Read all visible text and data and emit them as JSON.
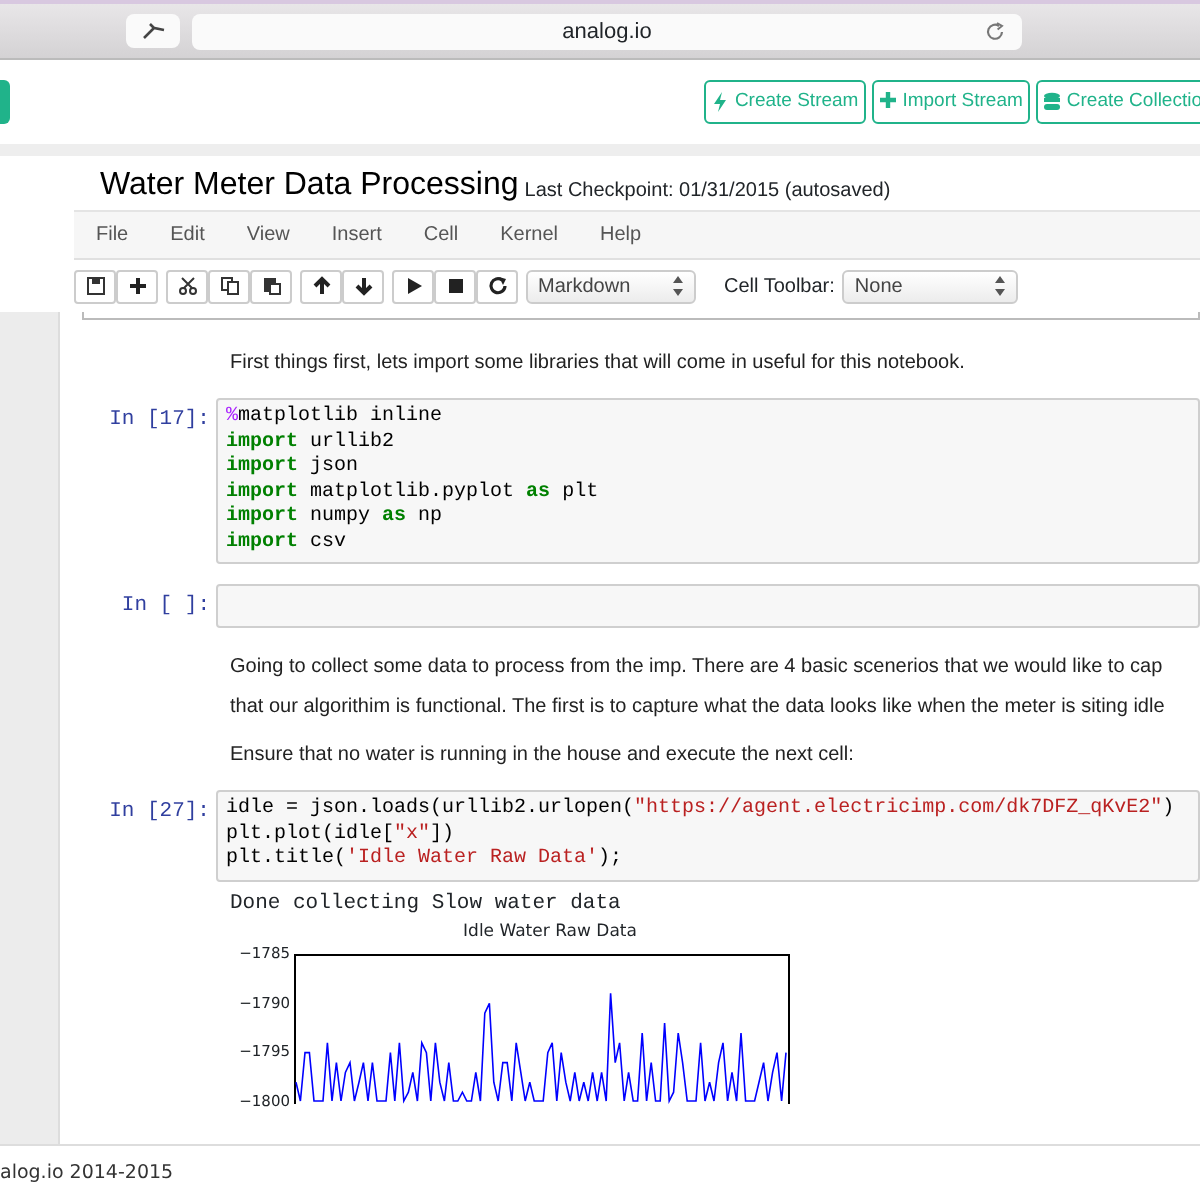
{
  "browser": {
    "address": "analog.io"
  },
  "header": {
    "buttons": [
      {
        "label": "Create Stream",
        "kind": "bolt"
      },
      {
        "label": "Import Stream",
        "kind": "plus"
      },
      {
        "label": "Create Collectio",
        "kind": "db"
      }
    ]
  },
  "notebook": {
    "title": "Water Meter Data Processing",
    "checkpoint": "Last Checkpoint: 01/31/2015 (autosaved)"
  },
  "menu": [
    "File",
    "Edit",
    "View",
    "Insert",
    "Cell",
    "Kernel",
    "Help"
  ],
  "toolbar": {
    "groups": [
      [
        {
          "kind": "save"
        },
        {
          "kind": "plus"
        }
      ],
      [
        {
          "kind": "cut"
        },
        {
          "kind": "copy"
        },
        {
          "kind": "paste"
        }
      ],
      [
        {
          "kind": "up"
        },
        {
          "kind": "down"
        }
      ],
      [
        {
          "kind": "run"
        },
        {
          "kind": "stop"
        },
        {
          "kind": "restart"
        }
      ]
    ],
    "cell_type": "Markdown",
    "cell_toolbar_label": "Cell Toolbar:",
    "cell_toolbar": "None"
  },
  "cells": [
    {
      "kind": "markdown",
      "paragraphs": [
        "First things first, lets import some libraries that will come in useful for this notebook."
      ]
    },
    {
      "kind": "code",
      "prompt": "In [17]:",
      "lines": [
        [
          {
            "text": "%",
            "kind": "magic"
          },
          {
            "text": "matplotlib inline",
            "kind": "plain"
          }
        ],
        [
          {
            "text": "import",
            "kind": "keyword"
          },
          {
            "text": " urllib2",
            "kind": "plain"
          }
        ],
        [
          {
            "text": "import",
            "kind": "keyword"
          },
          {
            "text": " json",
            "kind": "plain"
          }
        ],
        [
          {
            "text": "import",
            "kind": "keyword"
          },
          {
            "text": " matplotlib.pyplot ",
            "kind": "plain"
          },
          {
            "text": "as",
            "kind": "keyword"
          },
          {
            "text": " plt",
            "kind": "plain"
          }
        ],
        [
          {
            "text": "import",
            "kind": "keyword"
          },
          {
            "text": " numpy ",
            "kind": "plain"
          },
          {
            "text": "as",
            "kind": "keyword"
          },
          {
            "text": " np",
            "kind": "plain"
          }
        ],
        [
          {
            "text": "import",
            "kind": "keyword"
          },
          {
            "text": " csv",
            "kind": "plain"
          }
        ]
      ]
    },
    {
      "kind": "code",
      "prompt": "In [ ]:"
    },
    {
      "kind": "markdown",
      "paragraphs": [
        "Going to collect some data to process from the imp. There are 4 basic scenerios that we would like to cap",
        "that our algorithim is functional. The first is to capture what the data looks like when the meter is siting idle",
        "Ensure that no water is running in the house and execute the next cell:"
      ]
    },
    {
      "kind": "code",
      "prompt": "In [27]:",
      "lines": [
        [
          {
            "text": "idle = json.loads(urllib2.urlopen(",
            "kind": "plain"
          },
          {
            "text": "\"https://agent.electricimp.com/dk7DFZ_qKvE2\"",
            "kind": "string"
          },
          {
            "text": ")",
            "kind": "plain"
          }
        ],
        [
          {
            "text": "plt.plot(idle[",
            "kind": "plain"
          },
          {
            "text": "\"x\"",
            "kind": "string"
          },
          {
            "text": "])",
            "kind": "plain"
          }
        ],
        [
          {
            "text": "plt.title(",
            "kind": "plain"
          },
          {
            "text": "'Idle Water Raw Data'",
            "kind": "string"
          },
          {
            "text": ");",
            "kind": "plain"
          }
        ]
      ],
      "output": "Done collecting Slow water data",
      "plot": {
        "chart_data": {
          "type": "line",
          "title": "Idle Water Raw Data",
          "ylim": [
            -1800,
            -1785
          ],
          "yticks": [
            {
              "value": -1785,
              "label": "−1785"
            },
            {
              "value": -1790,
              "label": "−1790"
            },
            {
              "value": -1795,
              "label": "−1795"
            },
            {
              "value": -1800,
              "label": "−1800"
            }
          ],
          "series": [
            {
              "color": "#0000ff",
              "values": [
                -1798,
                -1800,
                -1795,
                -1795,
                -1800,
                -1800,
                -1800,
                -1794,
                -1800,
                -1796,
                -1800,
                -1797,
                -1796,
                -1800,
                -1798,
                -1796,
                -1800,
                -1796,
                -1800,
                -1800,
                -1800,
                -1795,
                -1800,
                -1794,
                -1800,
                -1799,
                -1797,
                -1800,
                -1794,
                -1795,
                -1800,
                -1794,
                -1798,
                -1800,
                -1796,
                -1800,
                -1800,
                -1799,
                -1800,
                -1800,
                -1797,
                -1800,
                -1791,
                -1790,
                -1798,
                -1800,
                -1796,
                -1796,
                -1800,
                -1794,
                -1797,
                -1800,
                -1798,
                -1800,
                -1800,
                -1800,
                -1795,
                -1794,
                -1800,
                -1795,
                -1798,
                -1800,
                -1797,
                -1800,
                -1798,
                -1800,
                -1797,
                -1800,
                -1797,
                -1800,
                -1789,
                -1796,
                -1794,
                -1800,
                -1797,
                -1800,
                -1800,
                -1793,
                -1800,
                -1796,
                -1800,
                -1800,
                -1792,
                -1800,
                -1799,
                -1793,
                -1796,
                -1800,
                -1800,
                -1800,
                -1794,
                -1800,
                -1798,
                -1800,
                -1796,
                -1794,
                -1800,
                -1797,
                -1800,
                -1793,
                -1800,
                -1800,
                -1800,
                -1798,
                -1796,
                -1800,
                -1797,
                -1795,
                -1800,
                -1795
              ]
            }
          ]
        }
      }
    }
  ],
  "footer": "alog.io 2014-2015"
}
